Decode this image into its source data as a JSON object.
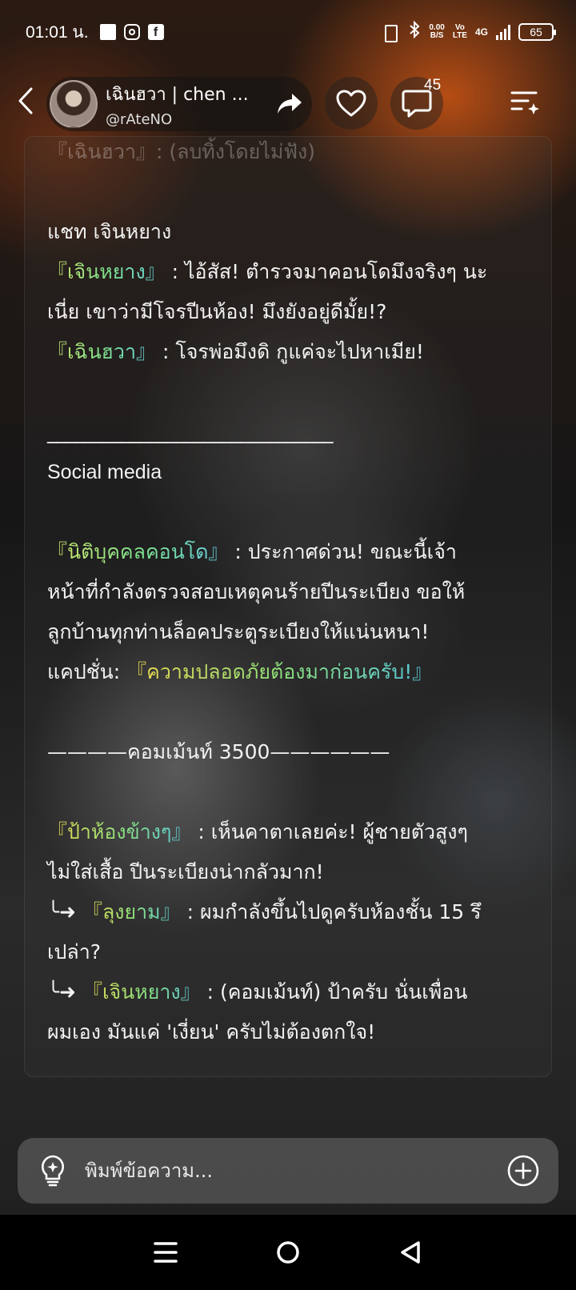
{
  "status_bar": {
    "time": "01:01 น.",
    "net_speed_top": "0.00",
    "net_speed_bottom": "B/S",
    "volte_top": "Vo",
    "volte_bottom": "LTE",
    "network": "4G",
    "battery": "65"
  },
  "header": {
    "name": "เฉินฮวา | chen ...",
    "handle": "@rAteNO",
    "comment_count": "45"
  },
  "content": {
    "faded_line": "『เฉินฮวา』: (ลบทิ้งโดยไม่ฟัง)",
    "chat_title": "แชท เจินหยาง",
    "chat1_tag": "『เจินหยาง』",
    "chat1_text_a": " : ไอ้สัส! ตำรวจมาคอนโดมึงจริงๆ นะ",
    "chat1_text_b": "เนี่ย เขาว่ามีโจรปีนห้อง! มึงยังอยู่ดีมั้ย!?",
    "chat2_tag": "『เฉินฮวา』",
    "chat2_text": " : โจรพ่อมึงดิ กูแค่จะไปหาเมีย!",
    "divider": "_______________________________",
    "social_title": "Social media",
    "post_tag": "『นิติบุคคลคอนโด』",
    "post_text_a": " : ประกาศด่วน! ขณะนี้เจ้า",
    "post_text_b": "หน้าที่กำลังตรวจสอบเหตุคนร้ายปีนระเบียง ขอให้",
    "post_text_c": "ลูกบ้านทุกท่านล็อคประตูระเบียงให้แน่นหนา!",
    "caption_label": "แคปชั่น: ",
    "caption_text": "『ความปลอดภัยต้องมาก่อนครับ!』",
    "comments_divider": "————คอมเม้นท์ 3500——————",
    "c1_tag": "『ป้าห้องข้างๆ』",
    "c1_text_a": " : เห็นคาตาเลยค่ะ! ผู้ชายตัวสูงๆ",
    "c1_text_b": "ไม่ใส่เสื้อ ปีนระเบียงน่ากลัวมาก!",
    "reply_arrow": "╰➜ ",
    "c2_tag": "『ลุงยาม』",
    "c2_text_a": " : ผมกำลังขึ้นไปดูครับห้องชั้น 15 รึ",
    "c2_text_b": "เปล่า?",
    "c3_tag": "『เจินหยาง』",
    "c3_text_a": " : (คอมเม้นท์) ป้าครับ นั่นเพื่อน",
    "c3_text_b": "ผมเอง มันแค่ 'เงี่ยน' ครับไม่ต้องตกใจ!"
  },
  "input": {
    "placeholder": "พิมพ์ข้อความ..."
  },
  "icons": {
    "back": "chevron-left-icon",
    "share": "share-arrow-icon",
    "like": "heart-icon",
    "comment": "chat-bubble-icon",
    "menu": "menu-sparkle-icon",
    "bulb": "lightbulb-icon",
    "plus": "plus-circle-icon"
  }
}
